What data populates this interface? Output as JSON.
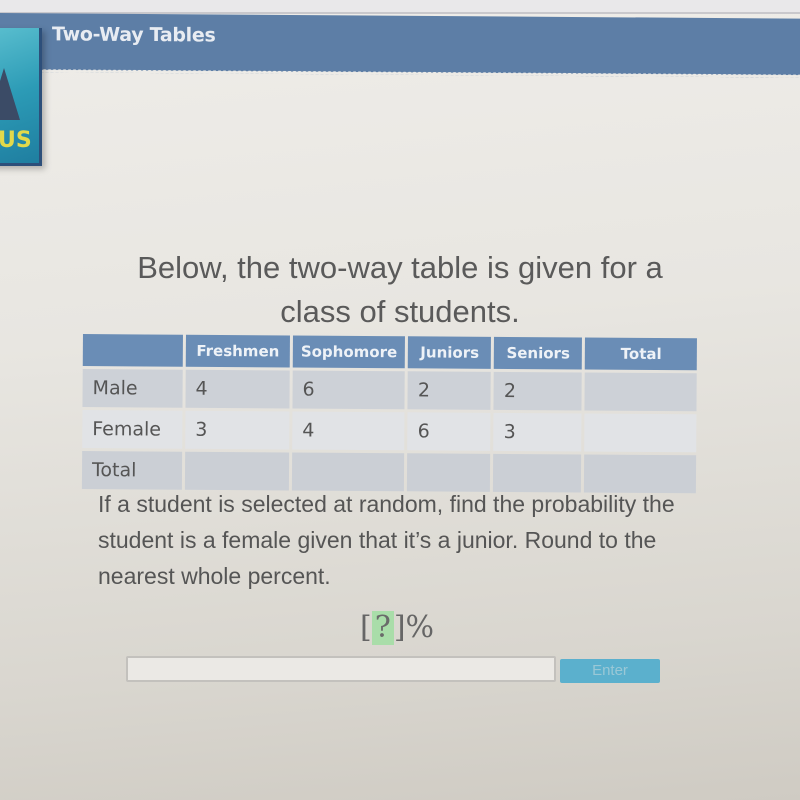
{
  "header": {
    "title": "Two-Way Tables",
    "logo_text": "US"
  },
  "prompt": {
    "line1": "Below, the two-way table is given for a",
    "line2": "class of students."
  },
  "table": {
    "columns": [
      "",
      "Freshmen",
      "Sophomore",
      "Juniors",
      "Seniors",
      "Total"
    ],
    "rows": [
      {
        "label": "Male",
        "values": [
          "4",
          "6",
          "2",
          "2",
          ""
        ]
      },
      {
        "label": "Female",
        "values": [
          "3",
          "4",
          "6",
          "3",
          ""
        ]
      },
      {
        "label": "Total",
        "values": [
          "",
          "",
          "",
          "",
          ""
        ]
      }
    ]
  },
  "question": {
    "text": "If a student is selected at random, find the probability the student is a female given that it’s a junior.  Round to the nearest whole percent."
  },
  "answer": {
    "open_bracket": "[",
    "blank": "?",
    "close_bracket": "]",
    "unit": "%",
    "input_value": "",
    "enter_label": "Enter"
  },
  "colors": {
    "header_bar": "#5d7ea6",
    "table_header": "#6a8db6",
    "blank_highlight": "#a9dda9",
    "enter_button": "#5bb0cd"
  }
}
